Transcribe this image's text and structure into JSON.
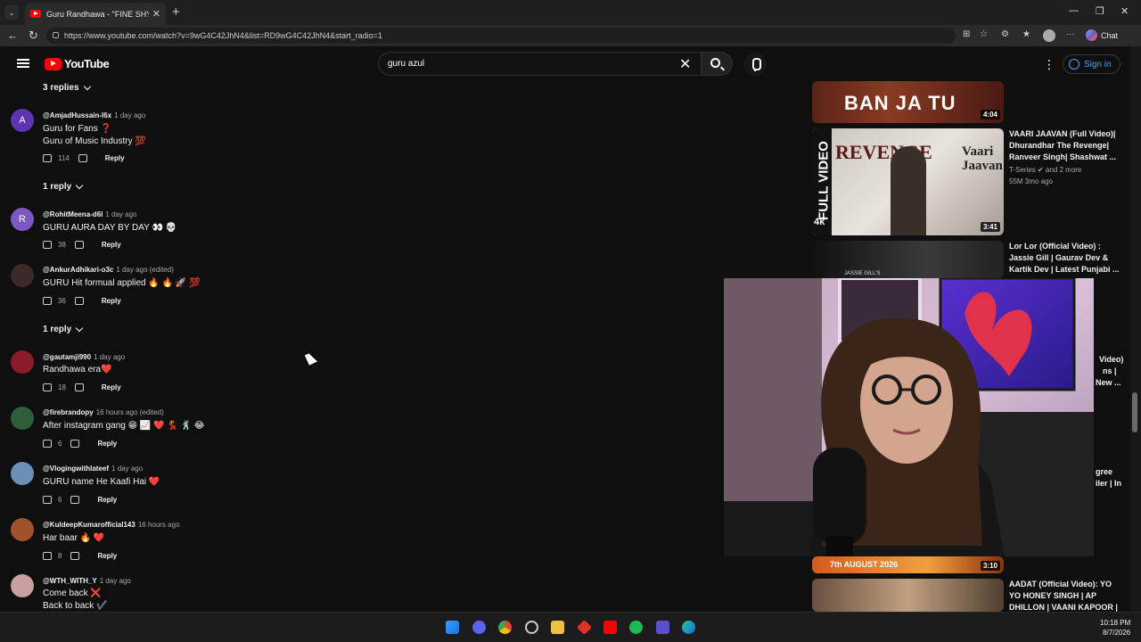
{
  "browser": {
    "tab_title": "Guru Randhawa - \"FINE SHYT\" M/V",
    "url": "https://www.youtube.com/watch?v=9wG4C42JhN4&list=RD9wG4C42JhN4&start_radio=1",
    "chat_label": "Chat"
  },
  "header": {
    "logo_text": "YouTube",
    "search_value": "guru azul",
    "signin_label": "Sign in"
  },
  "comments": {
    "toggles": [
      {
        "label": "3 replies"
      },
      {
        "label": "1 reply"
      },
      {
        "label": "1 reply"
      }
    ],
    "items": [
      {
        "initial": "A",
        "avatar_color": "#5e35b1",
        "author": "@AmjadHussain-l6x",
        "time": "1 day ago",
        "lines": [
          "Guru for Fans ❓",
          "Guru of Music Industry 💯"
        ],
        "likes": "114",
        "reply": "Reply"
      },
      {
        "initial": "R",
        "avatar_color": "#7e57c2",
        "author": "@RohitMeena-d6l",
        "time": "1 day ago",
        "lines": [
          "GURU AURA DAY BY DAY 👀 💀"
        ],
        "likes": "38",
        "reply": "Reply"
      },
      {
        "initial": "",
        "avatar_color": "#3a2a2a",
        "author": "@AnkurAdhikari-o3c",
        "time": "1 day ago (edited)",
        "lines": [
          "GURU Hit formual applied 🔥 🔥 🚀 💯"
        ],
        "likes": "36",
        "reply": "Reply"
      },
      {
        "initial": "",
        "avatar_color": "#8b1a2a",
        "author": "@gautamji990",
        "time": "1 day ago",
        "lines": [
          "Randhawa era❤️"
        ],
        "likes": "18",
        "reply": "Reply"
      },
      {
        "initial": "",
        "avatar_color": "#2e5d3a",
        "author": "@firebrandopy",
        "time": "16 hours ago (edited)",
        "lines": [
          "After instagram gang 😁 📈 ❤️ 💃 🕺 😂"
        ],
        "likes": "6",
        "reply": "Reply"
      },
      {
        "initial": "",
        "avatar_color": "#6b8fb5",
        "author": "@Vlogingwithlateef",
        "time": "1 day ago",
        "lines": [
          "GURU name He  Kaafi Hai ❤️"
        ],
        "likes": "6",
        "reply": "Reply"
      },
      {
        "initial": "",
        "avatar_color": "#a0522d",
        "author": "@KuldeepKumarofficial143",
        "time": "16 hours ago",
        "lines": [
          "Har baar 🔥 ❤️"
        ],
        "likes": "8",
        "reply": "Reply"
      },
      {
        "initial": "",
        "avatar_color": "#c9a0a0",
        "author": "@WTH_WITH_Y",
        "time": "1 day ago",
        "lines": [
          "Come back ❌",
          "Back to back ✔️"
        ],
        "likes": "",
        "reply": ""
      }
    ]
  },
  "recommendations": [
    {
      "thumb_text": "BAN JA TU",
      "duration": "4:04",
      "title": "",
      "channel": "",
      "stats": ""
    },
    {
      "thumb_text": "FULL VIDEO",
      "thumb_sub": "REVENGE",
      "duration": "3:41",
      "title": "VAARI JAAVAN (Full Video)| Dhurandhar The Revenge| Ranveer Singh| Shashwat ...",
      "channel": "T-Series ✔ and 2 more",
      "stats": "55M  3mo ago"
    },
    {
      "thumb_text": "",
      "duration": "",
      "title": "Lor Lor (Official Video) : Jassie Gill | Gaurav Dev & Kartik Dev | Latest Punjabi ...",
      "channel": "",
      "stats": ""
    },
    {
      "thumb_text": "7th AUGUST 2026",
      "duration": "3:10",
      "title": "",
      "channel": "",
      "stats": ""
    },
    {
      "thumb_text": "",
      "duration": "",
      "title": "AADAT (Official Video): YO YO HONEY SINGH | AP DHILLON | VAANI KAPOOR | ...",
      "channel": "",
      "stats": ""
    }
  ],
  "partial_titles": [
    "Video)",
    "ns |",
    "New ...",
    "gree",
    "iler | In"
  ],
  "taskbar": {
    "time": "10:18 PM",
    "date": "8/7/2026"
  }
}
